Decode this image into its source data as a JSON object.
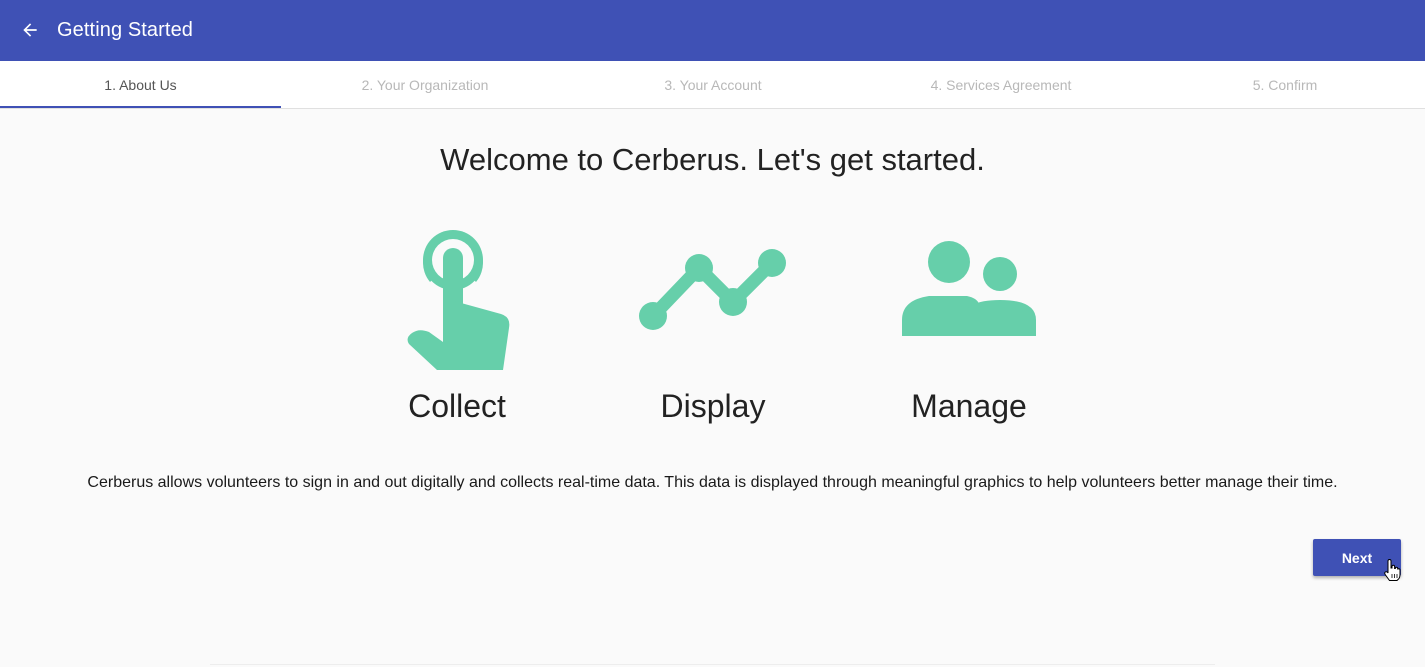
{
  "app_bar": {
    "title": "Getting Started",
    "back_icon": "arrow-back-icon",
    "background_color": "#3f51b5"
  },
  "stepper": {
    "tabs": [
      {
        "label": "1. About Us",
        "active": true
      },
      {
        "label": "2. Your Organization",
        "active": false
      },
      {
        "label": "3. Your Account",
        "active": false
      },
      {
        "label": "4. Services Agreement",
        "active": false
      },
      {
        "label": "5. Confirm",
        "active": false
      }
    ]
  },
  "main": {
    "heading": "Welcome to Cerberus. Let's get started.",
    "features": [
      {
        "label": "Collect",
        "icon": "touch-app-icon"
      },
      {
        "label": "Display",
        "icon": "timeline-icon"
      },
      {
        "label": "Manage",
        "icon": "people-icon"
      }
    ],
    "icon_color": "#66cfaa",
    "description": "Cerberus allows volunteers to sign in and out digitally and collects real-time data. This data is displayed through meaningful graphics to help volunteers better manage their time."
  },
  "actions": {
    "next_label": "Next",
    "accent_color": "#3f51b5"
  }
}
